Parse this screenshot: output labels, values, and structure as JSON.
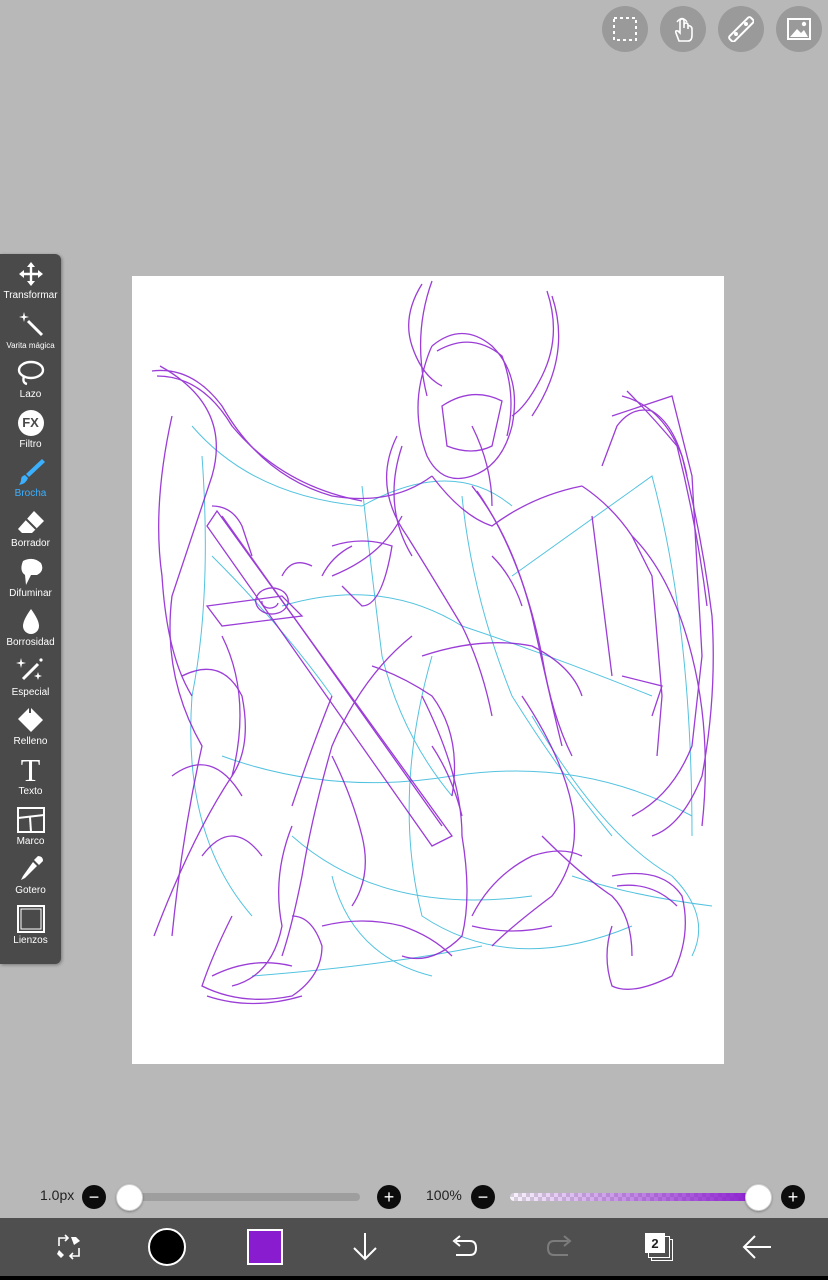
{
  "tools": [
    {
      "label": "Transformar",
      "icon": "move-arrows-icon"
    },
    {
      "label": "Varita mágica",
      "icon": "magic-wand-icon"
    },
    {
      "label": "Lazo",
      "icon": "lasso-icon"
    },
    {
      "label": "Filtro",
      "icon": "fx-filter-icon"
    },
    {
      "label": "Brocha",
      "icon": "brush-icon",
      "active": true
    },
    {
      "label": "Borrador",
      "icon": "eraser-icon"
    },
    {
      "label": "Difuminar",
      "icon": "smudge-icon"
    },
    {
      "label": "Borrosidad",
      "icon": "blur-drop-icon"
    },
    {
      "label": "Especial",
      "icon": "sparkle-pen-icon"
    },
    {
      "label": "Relleno",
      "icon": "fill-bucket-icon"
    },
    {
      "label": "Texto",
      "icon": "text-t-icon"
    },
    {
      "label": "Marco",
      "icon": "frame-divider-icon"
    },
    {
      "label": "Gotero",
      "icon": "eyedropper-icon"
    },
    {
      "label": "Lienzos",
      "icon": "canvas-icon"
    }
  ],
  "fx_label": "FX",
  "text_glyph": "T",
  "top_buttons": [
    "selection-icon",
    "hand-touch-icon",
    "ruler-icon",
    "image-icon"
  ],
  "brush_size": {
    "label": "1.0px",
    "value": 0.0
  },
  "opacity": {
    "label": "100%",
    "value": 1.0
  },
  "layer_count": "2",
  "colors": {
    "primary": "#000000",
    "secondary": "#8a1ccf",
    "sketch_purple": "#8a1ccf",
    "sketch_cyan": "#2ab4d8",
    "active_tool": "#3ab0ff"
  }
}
